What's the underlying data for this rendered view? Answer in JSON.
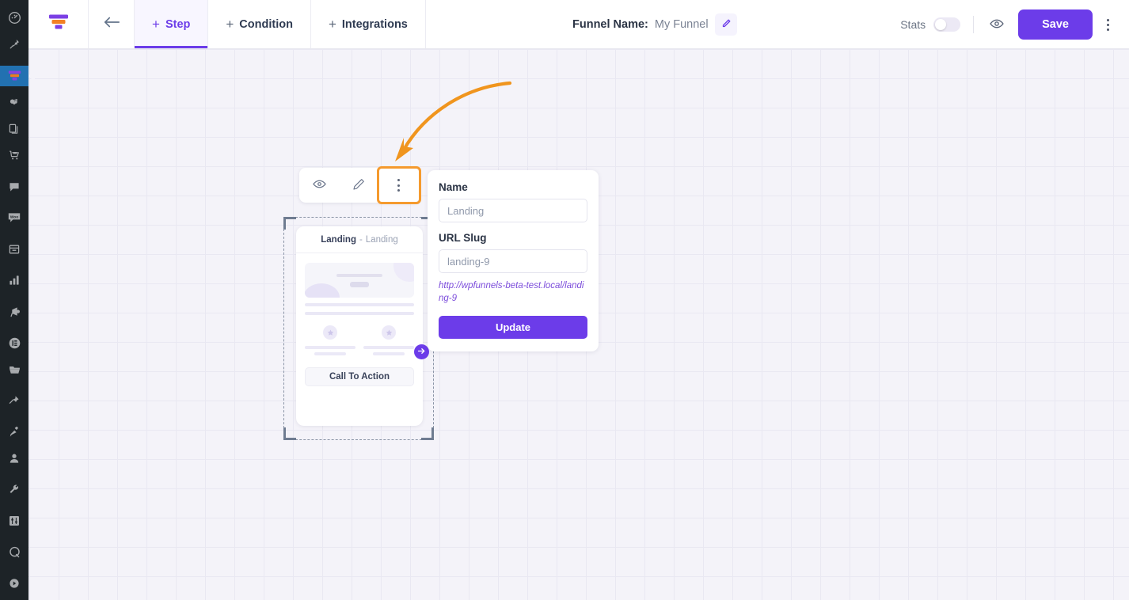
{
  "wp_sidebar": {
    "items": [
      {
        "icon": "dashboard-icon",
        "label": "Dashboard",
        "active": false
      },
      {
        "icon": "pin-icon",
        "label": "Posts",
        "active": false
      },
      {
        "icon": "funnel-icon",
        "label": "WP Funnels",
        "active": true
      },
      {
        "icon": "media-icon",
        "label": "Media",
        "active": false
      },
      {
        "icon": "pages-icon",
        "label": "Pages",
        "active": false
      },
      {
        "icon": "cart-icon",
        "label": "WooCommerce",
        "active": false
      },
      {
        "icon": "comments-icon",
        "label": "Comments",
        "active": false
      },
      {
        "icon": "woo-icon",
        "label": "Products",
        "active": false
      },
      {
        "icon": "archive-icon",
        "label": "Orders",
        "active": false
      },
      {
        "icon": "analytics-icon",
        "label": "Analytics",
        "active": false
      },
      {
        "icon": "megaphone-icon",
        "label": "Marketing",
        "active": false
      },
      {
        "icon": "elementor-icon",
        "label": "Elementor",
        "active": false
      },
      {
        "icon": "folder-icon",
        "label": "Templates",
        "active": false
      },
      {
        "icon": "pin2-icon",
        "label": "Appearance",
        "active": false
      },
      {
        "icon": "plugin-icon",
        "label": "Plugins",
        "active": false
      },
      {
        "icon": "user-icon",
        "label": "Users",
        "active": false
      },
      {
        "icon": "wrench-icon",
        "label": "Tools",
        "active": false
      },
      {
        "icon": "settings-icon",
        "label": "Settings",
        "active": false
      },
      {
        "icon": "q-icon",
        "label": "Query Monitor",
        "active": false
      },
      {
        "icon": "collapse-icon",
        "label": "Collapse menu",
        "active": false
      }
    ]
  },
  "topbar": {
    "brand_icon": "wpfunnels-logo-icon",
    "back_icon": "arrow-left-icon",
    "tabs": [
      {
        "label": "Step",
        "icon": "plus-icon",
        "active": true
      },
      {
        "label": "Condition",
        "icon": "plus-icon",
        "active": false
      },
      {
        "label": "Integrations",
        "icon": "plus-icon",
        "active": false
      }
    ],
    "funnel_name_label": "Funnel Name:",
    "funnel_name_value": "My Funnel",
    "edit_icon": "pencil-icon",
    "stats_label": "Stats",
    "stats_enabled": false,
    "preview_icon": "eye-icon",
    "save_label": "Save",
    "more_icon": "kebab-menu-icon"
  },
  "canvas": {
    "annotation": {
      "type": "curved-arrow",
      "color": "#f0951e"
    },
    "step_toolbar": {
      "buttons": [
        {
          "icon": "eye-icon",
          "name": "preview-step-button",
          "highlighted": false
        },
        {
          "icon": "pencil-icon",
          "name": "edit-step-button",
          "highlighted": false
        },
        {
          "icon": "kebab-menu-icon",
          "name": "step-options-button",
          "highlighted": true
        }
      ],
      "highlight_color": "#f59a2e"
    },
    "step_card": {
      "title": "Landing",
      "separator": "-",
      "subtitle": "Landing",
      "cta_label": "Call To Action",
      "connector_icon": "arrow-right-circle-icon",
      "selected": true
    }
  },
  "panel": {
    "name_label": "Name",
    "name_value": "Landing",
    "name_placeholder": "Landing",
    "slug_label": "URL Slug",
    "slug_value": "landing-9",
    "slug_placeholder": "landing-9",
    "url_preview": "http://wpfunnels-beta-test.local/landing-9",
    "update_label": "Update"
  },
  "colors": {
    "accent": "#6c3ce9",
    "highlight": "#f59a2e",
    "wp_admin_bg": "#1d2327",
    "wp_active": "#2271b1",
    "canvas_bg": "#f4f3f9",
    "grid_line": "#e9e8f2"
  }
}
